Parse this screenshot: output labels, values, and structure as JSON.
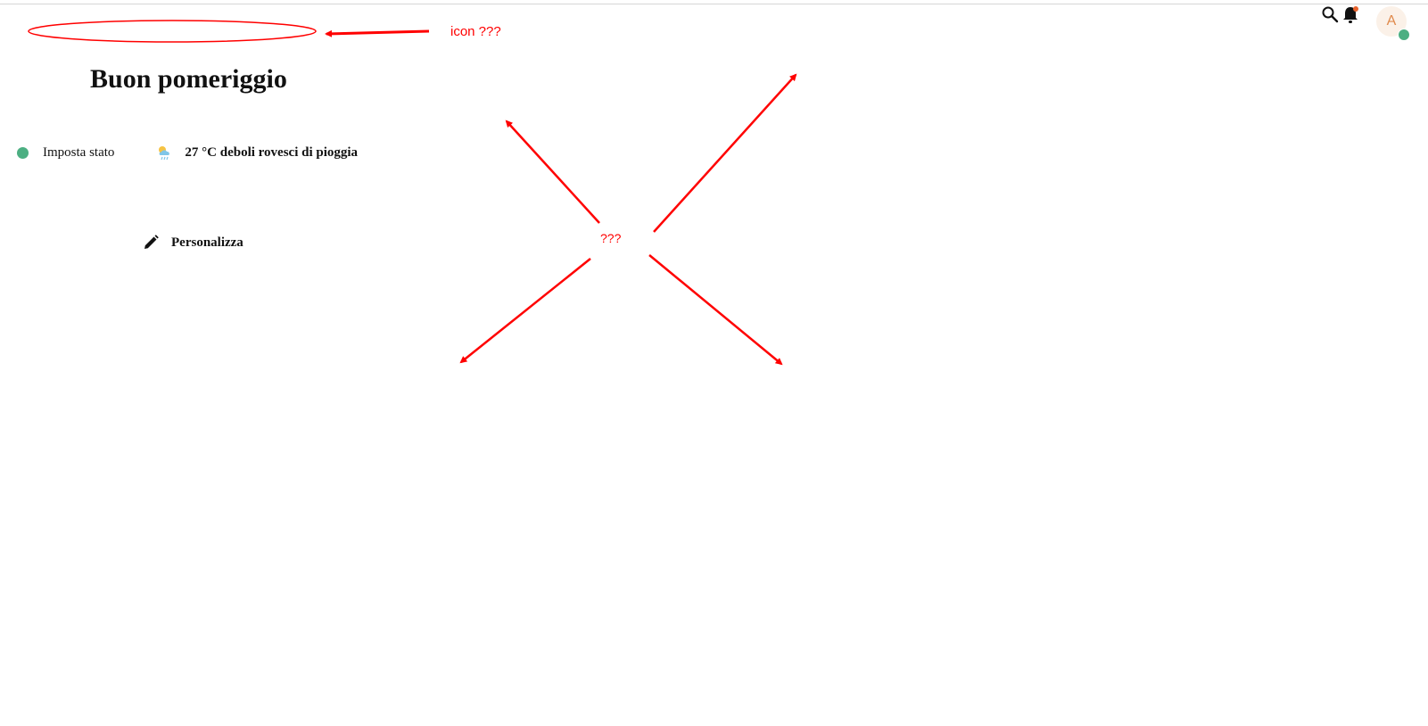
{
  "header": {
    "search_icon": "search-icon",
    "notifications_icon": "bell-icon",
    "avatar_initial": "A"
  },
  "greeting": "Buon pomeriggio",
  "status": {
    "label": "Imposta stato"
  },
  "weather": {
    "icon": "cloud-rain-sun-icon",
    "text": "27 °C deboli rovesci di pioggia"
  },
  "customize": {
    "label": "Personalizza",
    "icon": "pencil-icon"
  },
  "annotations": {
    "icon_note": "icon ???",
    "center_note": "???"
  },
  "colors": {
    "status_online": "#4caf82",
    "notification_dot": "#e8622c",
    "avatar_text": "#e08a4c",
    "annotation": "#ff0000",
    "weather_cloud": "#7fc6e8",
    "weather_sun": "#f6c343"
  }
}
